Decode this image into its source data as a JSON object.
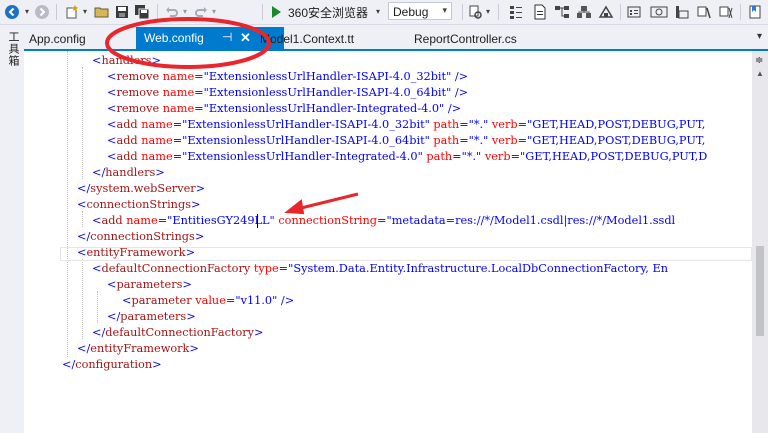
{
  "toolbar": {
    "browser_label": "360安全浏览器",
    "config_value": "Debug"
  },
  "rail": {
    "toolbox_label": "工具箱"
  },
  "tabs": [
    {
      "label": "App.config"
    },
    {
      "label": "Web.config"
    },
    {
      "label": "Model1.Context.tt"
    },
    {
      "label": "ReportController.cs"
    }
  ],
  "code_lines": [
    {
      "indent": 2,
      "segments": [
        [
          "br",
          "<"
        ],
        [
          "tag",
          "handlers"
        ],
        [
          "br",
          ">"
        ]
      ]
    },
    {
      "indent": 3,
      "segments": [
        [
          "br",
          "<"
        ],
        [
          "tag",
          "remove"
        ],
        [
          "txt",
          " "
        ],
        [
          "attr",
          "name"
        ],
        [
          "eq",
          "="
        ],
        [
          "str",
          "\"ExtensionlessUrlHandler-ISAPI-4.0_32bit\""
        ],
        [
          "txt",
          " "
        ],
        [
          "br",
          "/>"
        ]
      ]
    },
    {
      "indent": 3,
      "segments": [
        [
          "br",
          "<"
        ],
        [
          "tag",
          "remove"
        ],
        [
          "txt",
          " "
        ],
        [
          "attr",
          "name"
        ],
        [
          "eq",
          "="
        ],
        [
          "str",
          "\"ExtensionlessUrlHandler-ISAPI-4.0_64bit\""
        ],
        [
          "txt",
          " "
        ],
        [
          "br",
          "/>"
        ]
      ]
    },
    {
      "indent": 3,
      "segments": [
        [
          "br",
          "<"
        ],
        [
          "tag",
          "remove"
        ],
        [
          "txt",
          " "
        ],
        [
          "attr",
          "name"
        ],
        [
          "eq",
          "="
        ],
        [
          "str",
          "\"ExtensionlessUrlHandler-Integrated-4.0\""
        ],
        [
          "txt",
          " "
        ],
        [
          "br",
          "/>"
        ]
      ]
    },
    {
      "indent": 3,
      "segments": [
        [
          "br",
          "<"
        ],
        [
          "tag",
          "add"
        ],
        [
          "txt",
          " "
        ],
        [
          "attr",
          "name"
        ],
        [
          "eq",
          "="
        ],
        [
          "str",
          "\"ExtensionlessUrlHandler-ISAPI-4.0_32bit\""
        ],
        [
          "txt",
          " "
        ],
        [
          "attr",
          "path"
        ],
        [
          "eq",
          "="
        ],
        [
          "str",
          "\"*.\""
        ],
        [
          "txt",
          " "
        ],
        [
          "attr",
          "verb"
        ],
        [
          "eq",
          "="
        ],
        [
          "str",
          "\"GET,HEAD,POST,DEBUG,PUT,"
        ]
      ]
    },
    {
      "indent": 3,
      "segments": [
        [
          "br",
          "<"
        ],
        [
          "tag",
          "add"
        ],
        [
          "txt",
          " "
        ],
        [
          "attr",
          "name"
        ],
        [
          "eq",
          "="
        ],
        [
          "str",
          "\"ExtensionlessUrlHandler-ISAPI-4.0_64bit\""
        ],
        [
          "txt",
          " "
        ],
        [
          "attr",
          "path"
        ],
        [
          "eq",
          "="
        ],
        [
          "str",
          "\"*.\""
        ],
        [
          "txt",
          " "
        ],
        [
          "attr",
          "verb"
        ],
        [
          "eq",
          "="
        ],
        [
          "str",
          "\"GET,HEAD,POST,DEBUG,PUT,"
        ]
      ]
    },
    {
      "indent": 3,
      "segments": [
        [
          "br",
          "<"
        ],
        [
          "tag",
          "add"
        ],
        [
          "txt",
          " "
        ],
        [
          "attr",
          "name"
        ],
        [
          "eq",
          "="
        ],
        [
          "str",
          "\"ExtensionlessUrlHandler-Integrated-4.0\""
        ],
        [
          "txt",
          " "
        ],
        [
          "attr",
          "path"
        ],
        [
          "eq",
          "="
        ],
        [
          "str",
          "\"*.\""
        ],
        [
          "txt",
          " "
        ],
        [
          "attr",
          "verb"
        ],
        [
          "eq",
          "="
        ],
        [
          "str",
          "\"GET,HEAD,POST,DEBUG,PUT,D"
        ]
      ]
    },
    {
      "indent": 2,
      "segments": [
        [
          "br",
          "</"
        ],
        [
          "tag",
          "handlers"
        ],
        [
          "br",
          ">"
        ]
      ]
    },
    {
      "indent": 1,
      "segments": [
        [
          "br",
          "</"
        ],
        [
          "tag",
          "system.webServer"
        ],
        [
          "br",
          ">"
        ]
      ]
    },
    {
      "indent": 1,
      "segments": [
        [
          "br",
          "<"
        ],
        [
          "tag",
          "connectionStrings"
        ],
        [
          "br",
          ">"
        ]
      ]
    },
    {
      "indent": 2,
      "segments": [
        [
          "br",
          "<"
        ],
        [
          "tag",
          "add"
        ],
        [
          "txt",
          " "
        ],
        [
          "attr",
          "name"
        ],
        [
          "eq",
          "="
        ],
        [
          "str",
          "\"EntitiesGY249LL\""
        ],
        [
          "txt",
          " "
        ],
        [
          "attr",
          "connectionString"
        ],
        [
          "eq",
          "="
        ],
        [
          "str",
          "\"metadata=res://*/Model1.csdl|res://*/Model1.ssdl"
        ]
      ]
    },
    {
      "indent": 1,
      "segments": [
        [
          "br",
          "</"
        ],
        [
          "tag",
          "connectionStrings"
        ],
        [
          "br",
          ">"
        ]
      ]
    },
    {
      "indent": 1,
      "segments": [
        [
          "br",
          "<"
        ],
        [
          "tag",
          "entityFramework"
        ],
        [
          "br",
          ">"
        ]
      ]
    },
    {
      "indent": 2,
      "segments": [
        [
          "br",
          "<"
        ],
        [
          "tag",
          "defaultConnectionFactory"
        ],
        [
          "txt",
          " "
        ],
        [
          "attr",
          "type"
        ],
        [
          "eq",
          "="
        ],
        [
          "str",
          "\"System.Data.Entity.Infrastructure.LocalDbConnectionFactory, En"
        ]
      ]
    },
    {
      "indent": 3,
      "segments": [
        [
          "br",
          "<"
        ],
        [
          "tag",
          "parameters"
        ],
        [
          "br",
          ">"
        ]
      ]
    },
    {
      "indent": 4,
      "segments": [
        [
          "br",
          "<"
        ],
        [
          "tag",
          "parameter"
        ],
        [
          "txt",
          " "
        ],
        [
          "attr",
          "value"
        ],
        [
          "eq",
          "="
        ],
        [
          "str",
          "\"v11.0\""
        ],
        [
          "txt",
          " "
        ],
        [
          "br",
          "/>"
        ]
      ]
    },
    {
      "indent": 3,
      "segments": [
        [
          "br",
          "</"
        ],
        [
          "tag",
          "parameters"
        ],
        [
          "br",
          ">"
        ]
      ]
    },
    {
      "indent": 2,
      "segments": [
        [
          "br",
          "</"
        ],
        [
          "tag",
          "defaultConnectionFactory"
        ],
        [
          "br",
          ">"
        ]
      ]
    },
    {
      "indent": 1,
      "segments": [
        [
          "br",
          "</"
        ],
        [
          "tag",
          "entityFramework"
        ],
        [
          "br",
          ">"
        ]
      ]
    },
    {
      "indent": 0,
      "segments": [
        [
          "br",
          "</"
        ],
        [
          "tag",
          "configuration"
        ],
        [
          "br",
          ">"
        ]
      ]
    }
  ],
  "colors": {
    "accent": "#007acc",
    "annotation_red": "#e8262b",
    "xml_tag": "#a31515",
    "xml_attr": "#ff0000",
    "xml_value": "#0000ff"
  }
}
